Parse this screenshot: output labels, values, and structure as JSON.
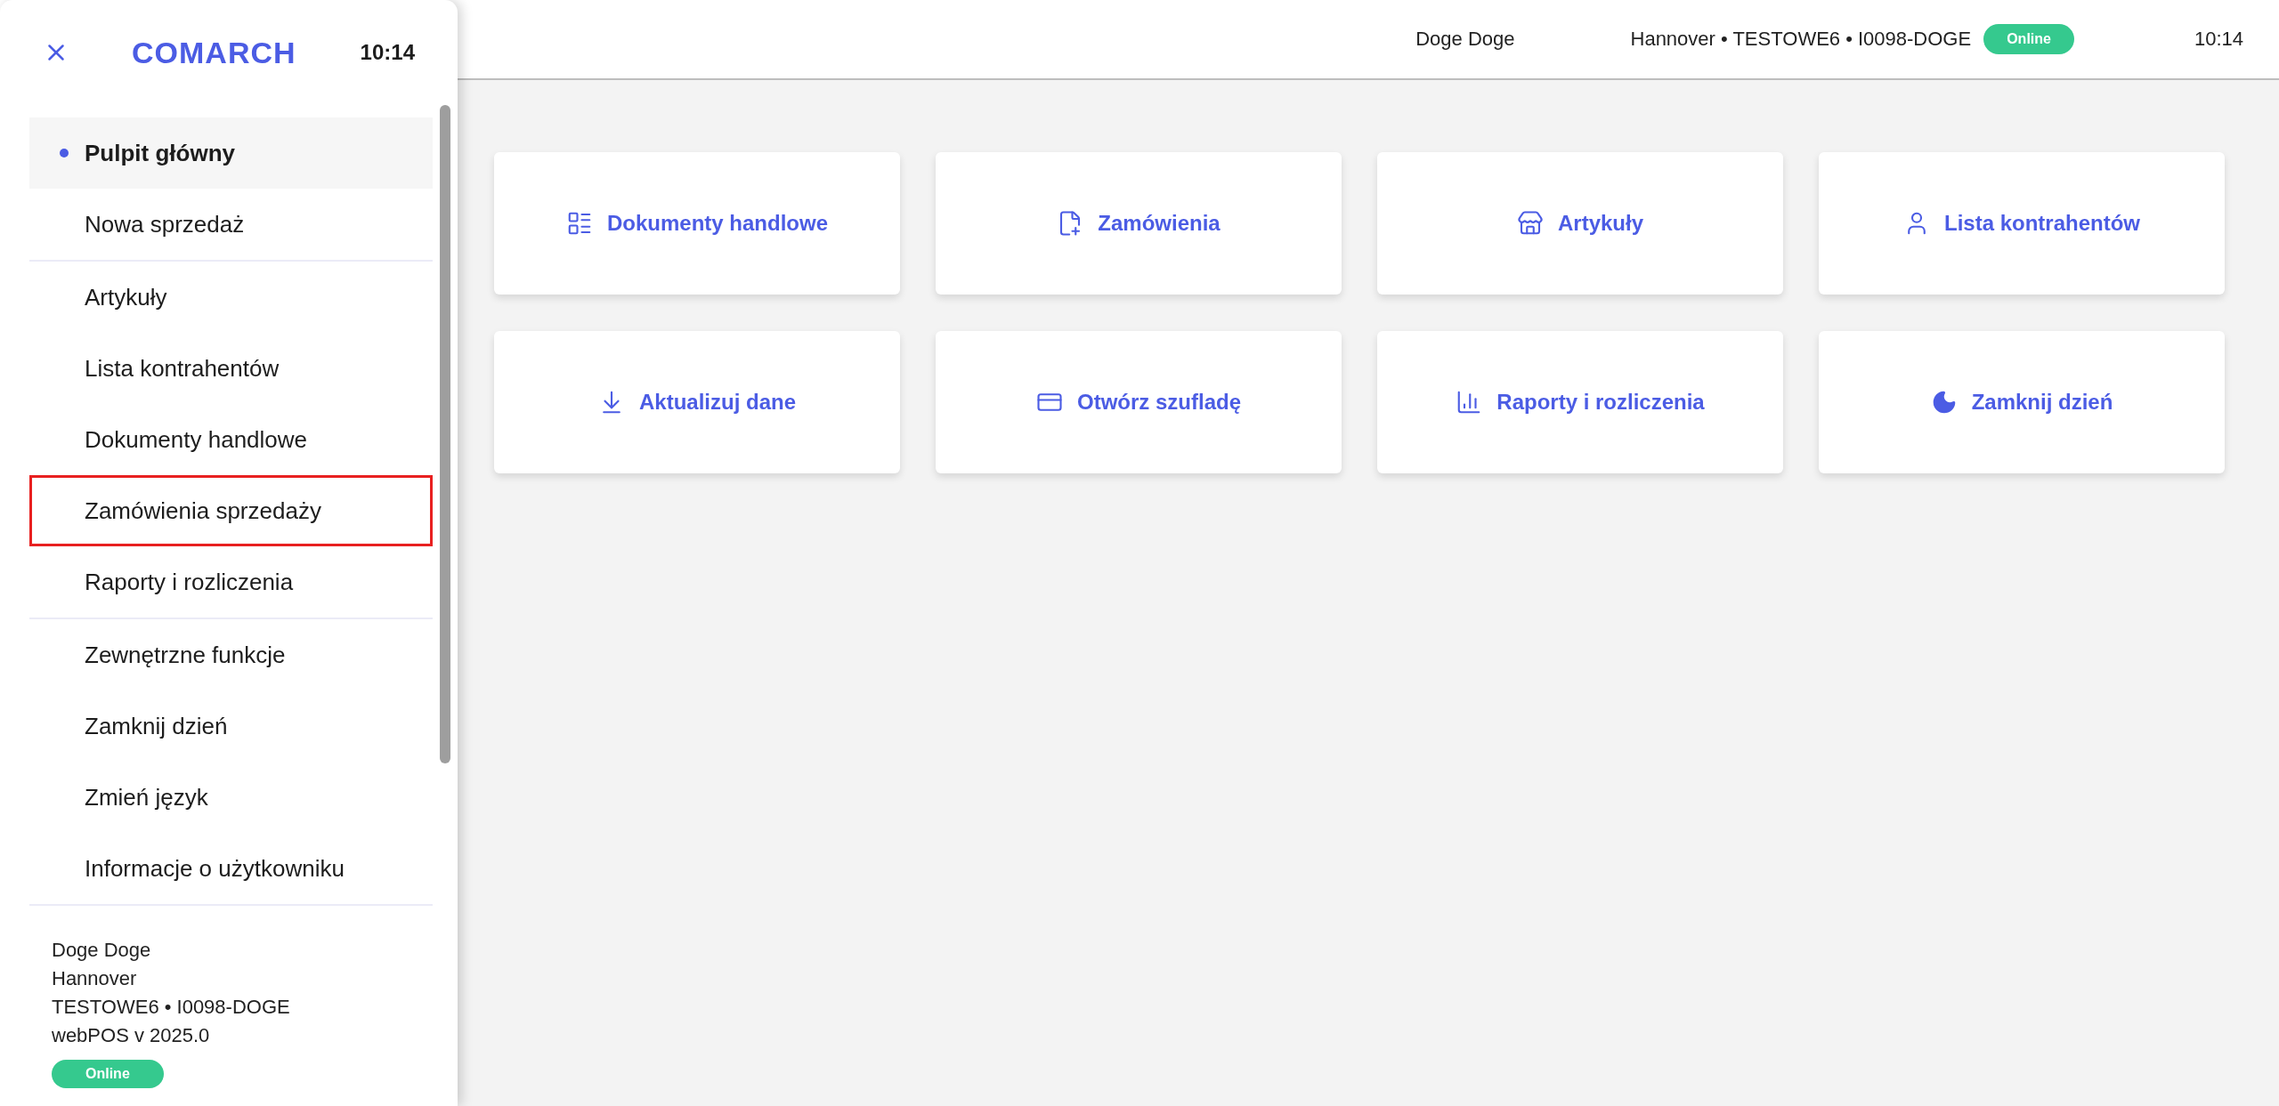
{
  "header": {
    "user": "Doge Doge",
    "location": "Hannover • TESTOWE6 • I0098-DOGE",
    "status": "Online",
    "time": "10:14"
  },
  "tiles": [
    {
      "label": "Dokumenty handlowe"
    },
    {
      "label": "Zamówienia"
    },
    {
      "label": "Artykuły"
    },
    {
      "label": "Lista kontrahentów"
    },
    {
      "label": "Aktualizuj dane"
    },
    {
      "label": "Otwórz szufladę"
    },
    {
      "label": "Raporty i rozliczenia"
    },
    {
      "label": "Zamknij dzień"
    }
  ],
  "drawer": {
    "logo": "COMARCH",
    "time": "10:14",
    "groups": [
      [
        {
          "label": "Pulpit główny",
          "selected": true,
          "highlighted": false
        },
        {
          "label": "Nowa sprzedaż",
          "selected": false,
          "highlighted": false
        }
      ],
      [
        {
          "label": "Artykuły",
          "selected": false,
          "highlighted": false
        },
        {
          "label": "Lista kontrahentów",
          "selected": false,
          "highlighted": false
        },
        {
          "label": "Dokumenty handlowe",
          "selected": false,
          "highlighted": false
        },
        {
          "label": "Zamówienia sprzedaży",
          "selected": false,
          "highlighted": true
        },
        {
          "label": "Raporty i rozliczenia",
          "selected": false,
          "highlighted": false
        }
      ],
      [
        {
          "label": "Zewnętrzne funkcje",
          "selected": false,
          "highlighted": false
        },
        {
          "label": "Zamknij dzień",
          "selected": false,
          "highlighted": false
        },
        {
          "label": "Zmień język",
          "selected": false,
          "highlighted": false
        },
        {
          "label": "Informacje o użytkowniku",
          "selected": false,
          "highlighted": false
        }
      ]
    ],
    "footer": {
      "lines": [
        "Doge Doge",
        "Hannover",
        "TESTOWE6 • I0098-DOGE",
        "webPOS v 2025.0"
      ],
      "status": "Online"
    }
  }
}
